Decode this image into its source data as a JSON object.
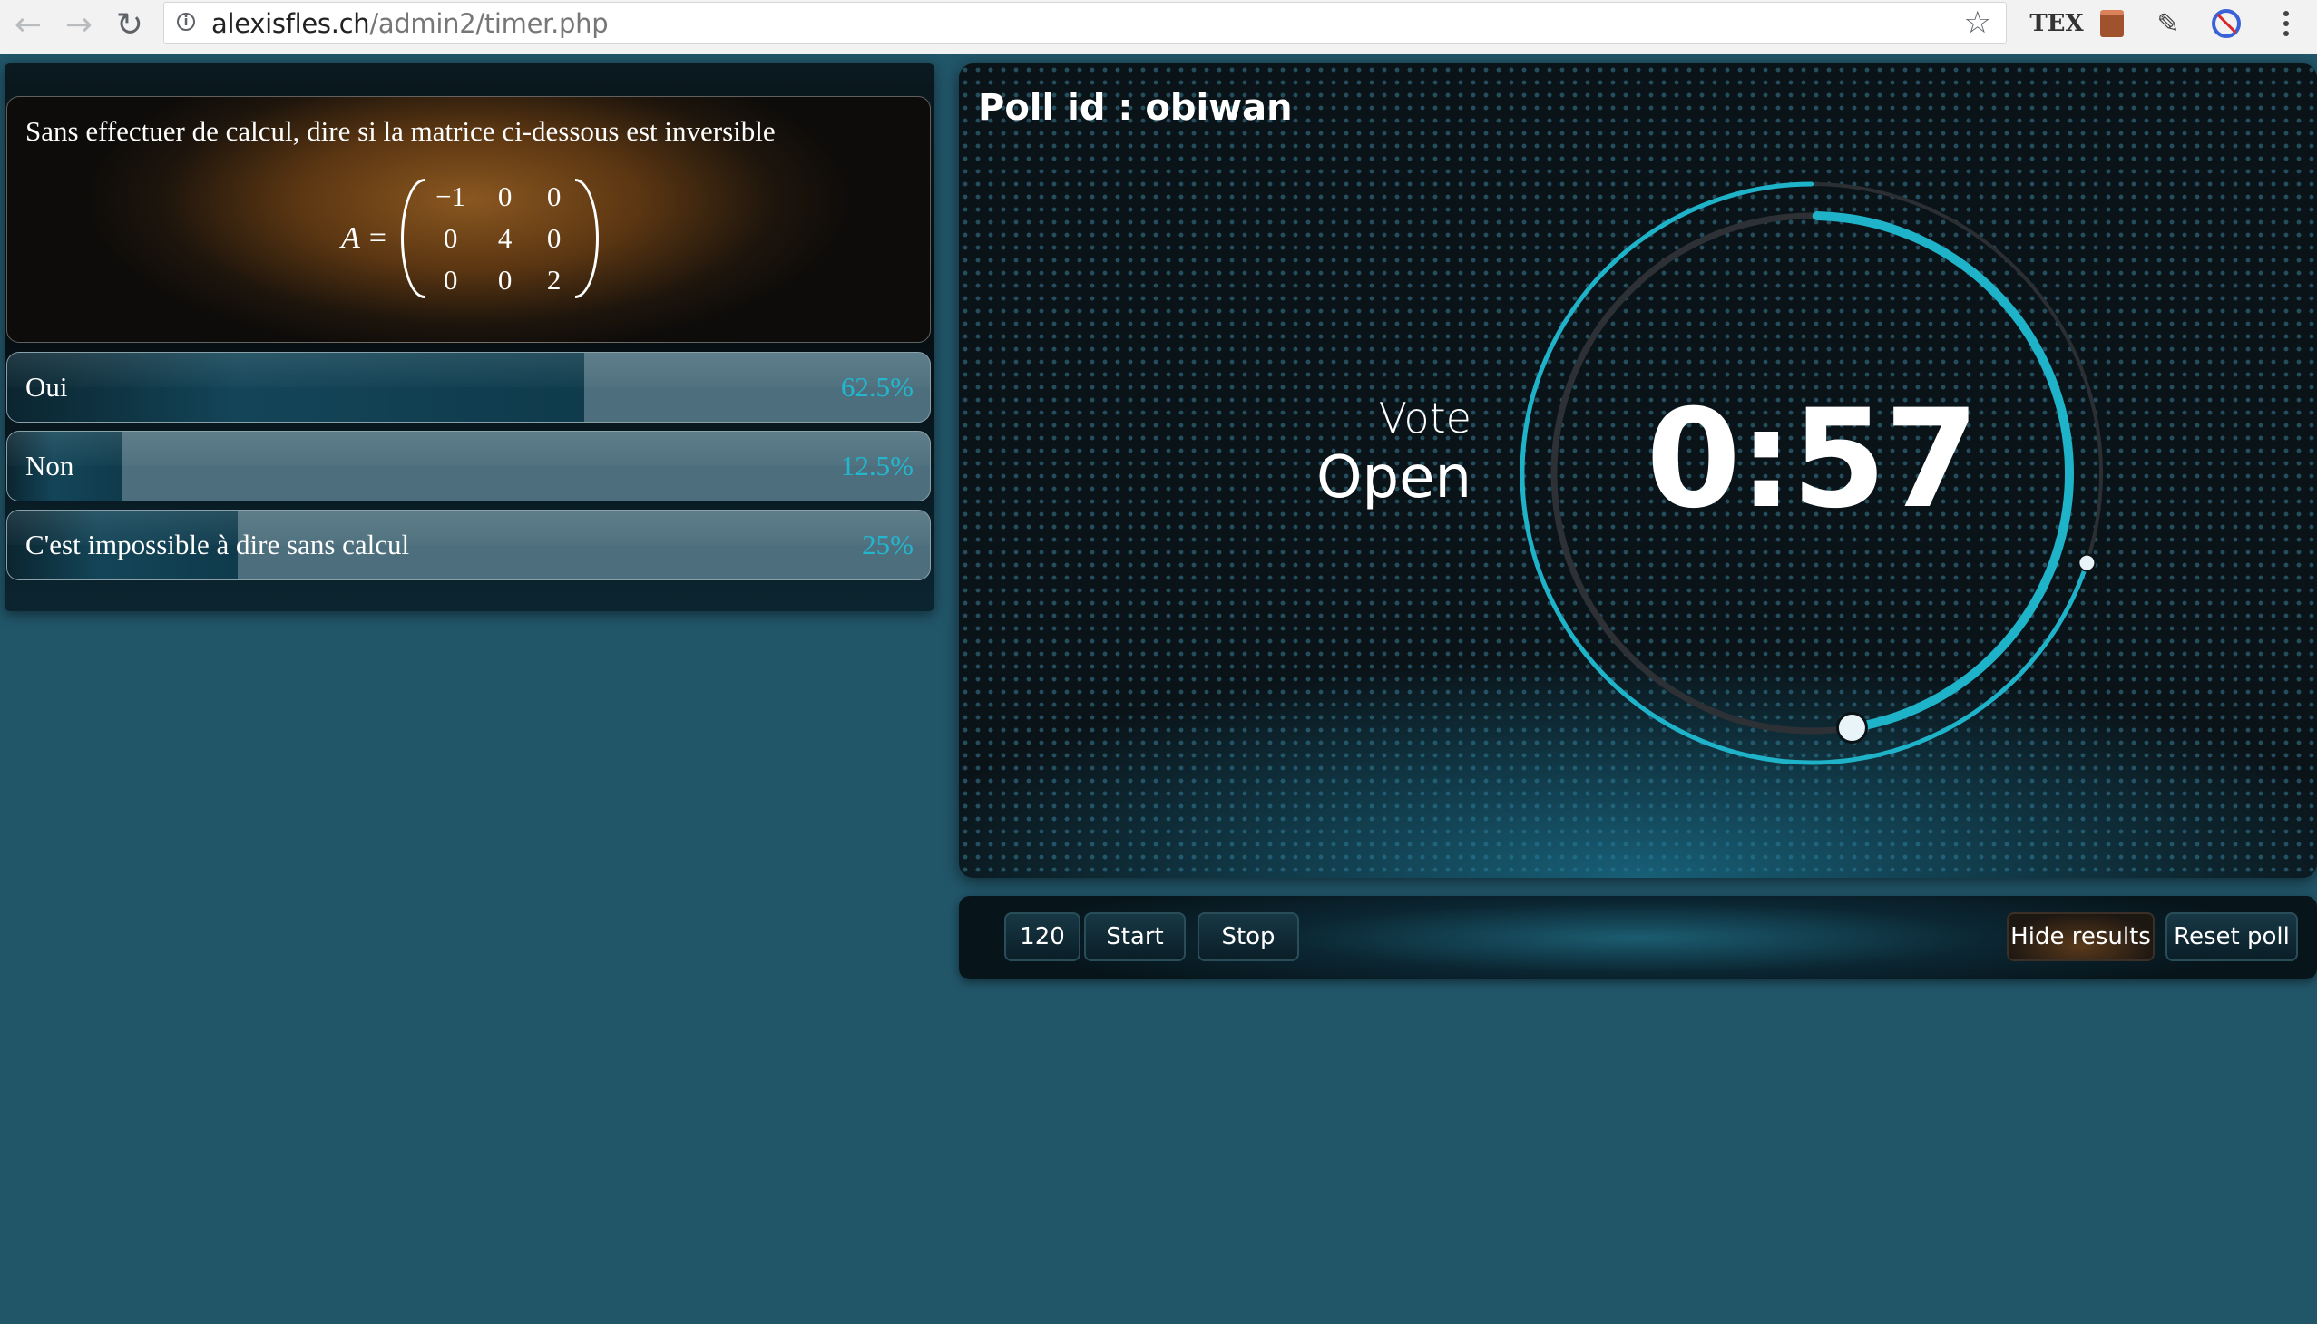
{
  "browser": {
    "url_host": "alexisfles.ch",
    "url_path": "/admin2/timer.php",
    "icons": [
      "back-icon",
      "forward-icon",
      "reload-icon",
      "info-icon",
      "star-icon",
      "tex-extension-icon",
      "film-extension-icon",
      "pen-extension-icon",
      "block-extension-icon",
      "menu-icon"
    ]
  },
  "question": {
    "text": "Sans effectuer de calcul, dire si la matrice ci-dessous est inversible",
    "matrix_lhs": "A =",
    "matrix": [
      [
        "−1",
        "0",
        "0"
      ],
      [
        "0",
        "4",
        "0"
      ],
      [
        "0",
        "0",
        "2"
      ]
    ]
  },
  "answers": [
    {
      "label": "Oui",
      "percent": "62.5%",
      "value": 62.5
    },
    {
      "label": "Non",
      "percent": "12.5%",
      "value": 12.5
    },
    {
      "label": "C'est impossible à dire sans calcul",
      "percent": "25%",
      "value": 25
    }
  ],
  "timer": {
    "poll_id_label": "Poll id : obiwan",
    "vote_label": "Vote",
    "status": "Open",
    "time": "0:57",
    "remaining_fraction": 0.475,
    "accent_color": "#1fb3c9"
  },
  "controls": {
    "duration": "120",
    "start_label": "Start",
    "stop_label": "Stop",
    "hide_results_label": "Hide results",
    "reset_label": "Reset poll"
  }
}
